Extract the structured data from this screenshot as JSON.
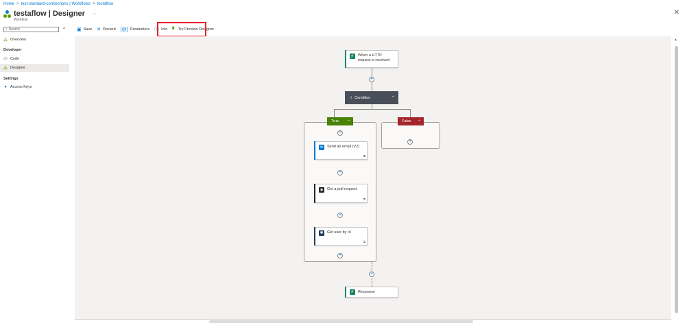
{
  "breadcrumb": {
    "home": "Home",
    "connections": "test-standard-connections | Workflows",
    "current": "testaflow",
    "sep": ">"
  },
  "header": {
    "title": "testaflow | Designer",
    "subtitle": "Workflow",
    "more": "···",
    "close": "✕"
  },
  "sidebar": {
    "search_placeholder": "Search",
    "collapse": "«",
    "overview": "Overview",
    "developer_heading": "Developer",
    "code": "Code",
    "designer": "Designer",
    "settings_heading": "Settings",
    "access_keys": "Access Keys"
  },
  "toolbar": {
    "save": "Save",
    "discard": "Discard",
    "parameters": "Parameters",
    "info": "Info",
    "preview": "Try Preview Designer"
  },
  "flow": {
    "trigger": "When a HTTP request is received",
    "condition": "Condition",
    "true_label": "True",
    "false_label": "False",
    "email": "Send an email (V2)",
    "pull_request": "Get a pull request",
    "user": "Get user by Id",
    "response": "Response",
    "plus": "+"
  },
  "colors": {
    "accent": "#0078d4",
    "true_branch": "#498205",
    "false_branch": "#a4262c",
    "condition": "#484f58",
    "highlight": "#e8212e"
  }
}
